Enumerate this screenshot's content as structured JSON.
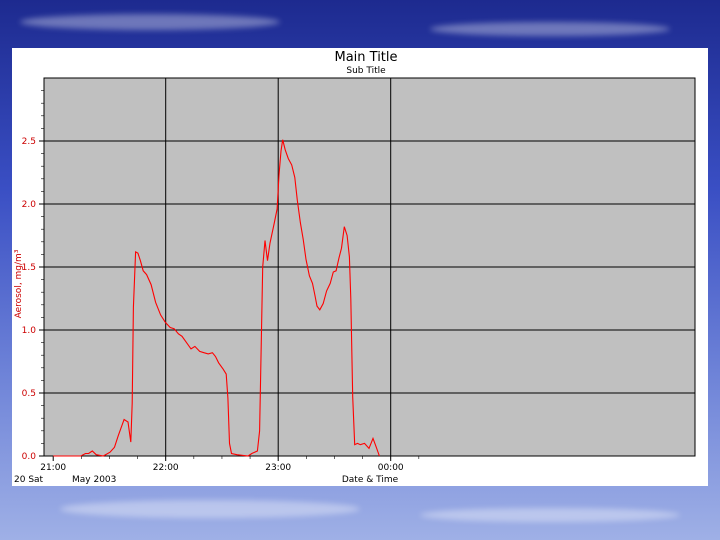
{
  "background": {
    "gradient_top": "#1d2a8f",
    "gradient_bottom": "#9fb0e6"
  },
  "chart_data": {
    "type": "line",
    "title": "Main Title",
    "subtitle": "Sub Title",
    "ylabel": "Aerosol, mg/m³",
    "xlabel": "Date & Time",
    "date_label_left": "20 Sat",
    "date_label_month": "May 2003",
    "x_axis": {
      "unit": "minutes after 21:00",
      "range": [
        0,
        116
      ]
    },
    "x_ticks": [
      {
        "x": 0,
        "label": "21:00"
      },
      {
        "x": 40,
        "label": "22:00"
      },
      {
        "x": 80,
        "label": "23:00"
      },
      {
        "x": 120,
        "label": "00:00"
      }
    ],
    "y_axis": {
      "range": [
        0,
        3.0
      ]
    },
    "y_ticks": [
      {
        "y": 0.0,
        "label": "0.0"
      },
      {
        "y": 0.5,
        "label": "0.5"
      },
      {
        "y": 1.0,
        "label": "1.0"
      },
      {
        "y": 1.5,
        "label": "1.5"
      },
      {
        "y": 2.0,
        "label": "2.0"
      },
      {
        "y": 2.5,
        "label": "2.5"
      }
    ],
    "grid": true,
    "plot_background": "#c0c0c0",
    "line_color": "#ff0000",
    "series": [
      {
        "values": [
          [
            0.0,
            0.0
          ],
          [
            5.0,
            0.0
          ],
          [
            9.8,
            0.0
          ],
          [
            11.5,
            0.02
          ],
          [
            12.6,
            0.02
          ],
          [
            13.9,
            0.04
          ],
          [
            15.3,
            0.01
          ],
          [
            17.8,
            0.0
          ],
          [
            20.2,
            0.03
          ],
          [
            21.8,
            0.07
          ],
          [
            23.1,
            0.16
          ],
          [
            25.2,
            0.29
          ],
          [
            26.6,
            0.27
          ],
          [
            27.6,
            0.11
          ],
          [
            28.1,
            0.42
          ],
          [
            28.5,
            1.18
          ],
          [
            29.3,
            1.62
          ],
          [
            30.1,
            1.61
          ],
          [
            31.0,
            1.55
          ],
          [
            32.0,
            1.47
          ],
          [
            33.2,
            1.44
          ],
          [
            34.8,
            1.36
          ],
          [
            36.4,
            1.22
          ],
          [
            38.2,
            1.12
          ],
          [
            39.9,
            1.06
          ],
          [
            41.6,
            1.02
          ],
          [
            43.0,
            1.01
          ],
          [
            44.5,
            0.97
          ],
          [
            45.8,
            0.95
          ],
          [
            47.4,
            0.9
          ],
          [
            49.0,
            0.85
          ],
          [
            50.4,
            0.87
          ],
          [
            52.1,
            0.83
          ],
          [
            53.6,
            0.82
          ],
          [
            55.1,
            0.81
          ],
          [
            56.6,
            0.82
          ],
          [
            57.7,
            0.79
          ],
          [
            58.8,
            0.74
          ],
          [
            60.4,
            0.69
          ],
          [
            61.5,
            0.65
          ],
          [
            62.1,
            0.46
          ],
          [
            62.7,
            0.1
          ],
          [
            63.4,
            0.02
          ],
          [
            65.3,
            0.01
          ],
          [
            69.3,
            0.0
          ],
          [
            70.6,
            0.02
          ],
          [
            72.6,
            0.04
          ],
          [
            73.4,
            0.2
          ],
          [
            74.5,
            1.5
          ],
          [
            75.3,
            1.71
          ],
          [
            76.2,
            1.55
          ],
          [
            77.1,
            1.69
          ],
          [
            78.6,
            1.85
          ],
          [
            79.6,
            1.96
          ],
          [
            80.3,
            2.23
          ],
          [
            81.0,
            2.42
          ],
          [
            81.6,
            2.51
          ],
          [
            82.5,
            2.43
          ],
          [
            83.6,
            2.36
          ],
          [
            84.8,
            2.31
          ],
          [
            85.9,
            2.21
          ],
          [
            86.8,
            2.03
          ],
          [
            87.9,
            1.85
          ],
          [
            88.9,
            1.72
          ],
          [
            89.9,
            1.56
          ],
          [
            91.1,
            1.43
          ],
          [
            92.2,
            1.37
          ],
          [
            93.0,
            1.28
          ],
          [
            93.8,
            1.19
          ],
          [
            94.8,
            1.16
          ],
          [
            96.0,
            1.21
          ],
          [
            97.2,
            1.31
          ],
          [
            98.5,
            1.37
          ],
          [
            99.6,
            1.46
          ],
          [
            100.6,
            1.47
          ],
          [
            101.6,
            1.57
          ],
          [
            102.5,
            1.65
          ],
          [
            103.5,
            1.82
          ],
          [
            104.5,
            1.75
          ],
          [
            105.3,
            1.58
          ],
          [
            105.8,
            1.25
          ],
          [
            106.5,
            0.47
          ],
          [
            107.2,
            0.09
          ],
          [
            108.2,
            0.1
          ],
          [
            109.2,
            0.09
          ],
          [
            110.7,
            0.1
          ],
          [
            112.3,
            0.06
          ],
          [
            113.7,
            0.14
          ],
          [
            114.7,
            0.08
          ],
          [
            116.0,
            0.0
          ]
        ]
      }
    ]
  }
}
